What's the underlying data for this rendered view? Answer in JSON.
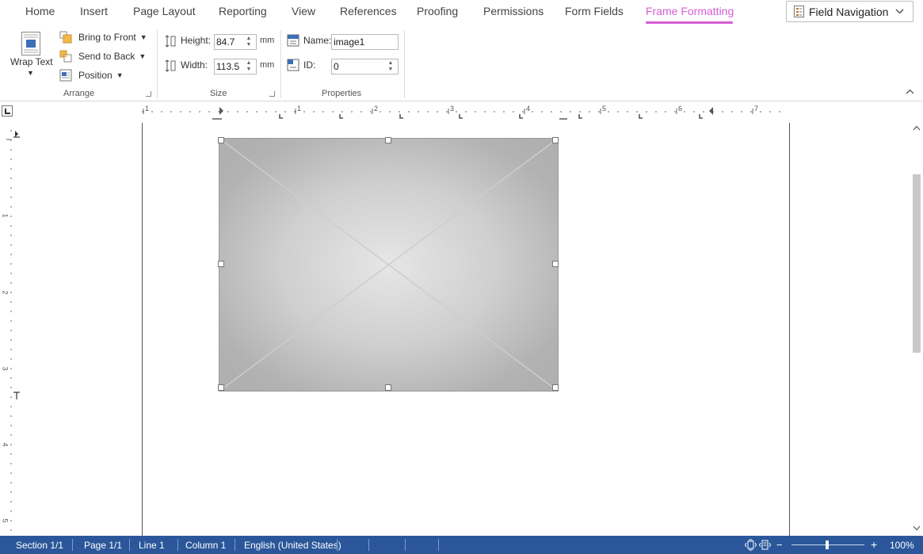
{
  "tabs": [
    {
      "label": "Home"
    },
    {
      "label": "Insert"
    },
    {
      "label": "Page Layout"
    },
    {
      "label": "Reporting"
    },
    {
      "label": "View"
    },
    {
      "label": "References"
    },
    {
      "label": "Proofing"
    },
    {
      "label": "Permissions"
    },
    {
      "label": "Form Fields"
    },
    {
      "label": "Frame Formatting",
      "active": true
    }
  ],
  "field_navigation": {
    "label": "Field Navigation"
  },
  "ribbon": {
    "arrange": {
      "label": "Arrange",
      "wrap_text": "Wrap Text",
      "bring_to_front": "Bring to Front",
      "send_to_back": "Send to Back",
      "position": "Position"
    },
    "size": {
      "label": "Size",
      "height_label": "Height:",
      "height_value": "84.7",
      "width_label": "Width:",
      "width_value": "113.5",
      "unit": "mm"
    },
    "properties": {
      "label": "Properties",
      "name_label": "Name:",
      "name_value": "image1",
      "id_label": "ID:",
      "id_value": "0"
    }
  },
  "ruler": {
    "h_numbers": [
      "1",
      "1",
      "2",
      "3",
      "4",
      "5",
      "6",
      "7"
    ],
    "v_numbers": [
      "1",
      "2",
      "3",
      "4",
      "5"
    ]
  },
  "status": {
    "section": "Section 1/1",
    "page": "Page 1/1",
    "line": "Line 1",
    "column": "Column 1",
    "language": "English (United States)",
    "zoom": "100%"
  },
  "colors": {
    "accent_tab": "#d65ed4",
    "statusbar": "#2b579a"
  },
  "icons": [
    "wrap-text-icon",
    "bring-to-front-icon",
    "send-to-back-icon",
    "position-icon",
    "height-icon",
    "width-icon",
    "name-icon",
    "id-icon",
    "field-navigation-icon",
    "tab-selector-icon"
  ]
}
